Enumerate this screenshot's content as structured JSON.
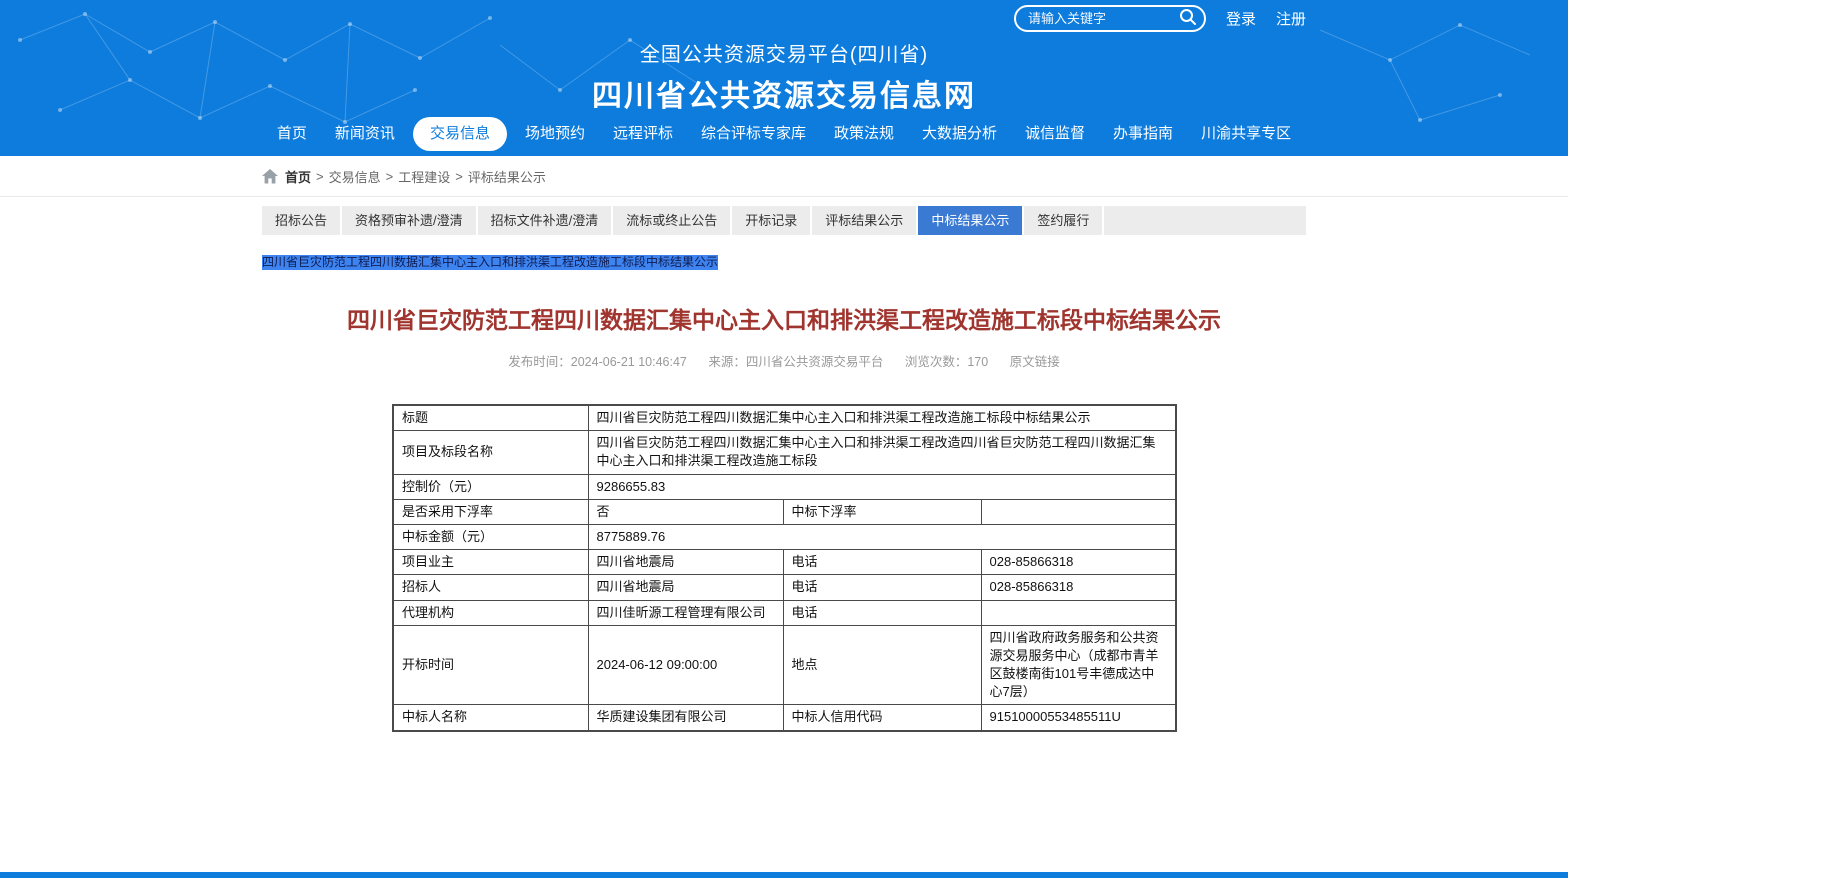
{
  "colors": {
    "header_blue": "#0d7cdd",
    "active_tab_blue": "#3b7ad3",
    "title_red": "#a0342e",
    "selection_blue": "#3d84f0"
  },
  "header": {
    "search_placeholder": "请输入关键字",
    "login_label": "登录",
    "register_label": "注册",
    "platform_title": "全国公共资源交易平台(四川省)",
    "site_title": "四川省公共资源交易信息网",
    "nav": [
      {
        "label": "首页"
      },
      {
        "label": "新闻资讯"
      },
      {
        "label": "交易信息",
        "active": true
      },
      {
        "label": "场地预约"
      },
      {
        "label": "远程评标"
      },
      {
        "label": "综合评标专家库"
      },
      {
        "label": "政策法规"
      },
      {
        "label": "大数据分析"
      },
      {
        "label": "诚信监督"
      },
      {
        "label": "办事指南"
      },
      {
        "label": "川渝共享专区"
      }
    ]
  },
  "breadcrumb": {
    "home_label": "首页",
    "items": [
      "交易信息",
      "工程建设",
      "评标结果公示"
    ]
  },
  "tabs": [
    {
      "label": "招标公告"
    },
    {
      "label": "资格预审补遗/澄清"
    },
    {
      "label": "招标文件补遗/澄清"
    },
    {
      "label": "流标或终止公告"
    },
    {
      "label": "开标记录"
    },
    {
      "label": "评标结果公示"
    },
    {
      "label": "中标结果公示",
      "active": true
    },
    {
      "label": "签约履行"
    }
  ],
  "selection_link": "四川省巨灾防范工程四川数据汇集中心主入口和排洪渠工程改造施工标段中标结果公示",
  "article": {
    "title": "四川省巨灾防范工程四川数据汇集中心主入口和排洪渠工程改造施工标段中标结果公示",
    "meta": {
      "publish": "发布时间：2024-06-21 10:46:47",
      "source": "来源：四川省公共资源交易平台",
      "views": "浏览次数：170",
      "original_link": "原文链接"
    }
  },
  "table": {
    "rows": [
      {
        "cells": [
          {
            "text": "标题"
          },
          {
            "text": "四川省巨灾防范工程四川数据汇集中心主入口和排洪渠工程改造施工标段中标结果公示",
            "colspan": 3
          }
        ]
      },
      {
        "cells": [
          {
            "text": "项目及标段名称"
          },
          {
            "text": "四川省巨灾防范工程四川数据汇集中心主入口和排洪渠工程改造四川省巨灾防范工程四川数据汇集中心主入口和排洪渠工程改造施工标段",
            "colspan": 3
          }
        ]
      },
      {
        "cells": [
          {
            "text": "控制价（元）"
          },
          {
            "text": "9286655.83",
            "colspan": 3
          }
        ]
      },
      {
        "cells": [
          {
            "text": "是否采用下浮率"
          },
          {
            "text": "否"
          },
          {
            "text": "中标下浮率"
          },
          {
            "text": ""
          }
        ]
      },
      {
        "cells": [
          {
            "text": "中标金额（元）"
          },
          {
            "text": "8775889.76",
            "colspan": 3
          }
        ]
      },
      {
        "cells": [
          {
            "text": "项目业主"
          },
          {
            "text": "四川省地震局"
          },
          {
            "text": "电话"
          },
          {
            "text": "028-85866318"
          }
        ]
      },
      {
        "cells": [
          {
            "text": "招标人"
          },
          {
            "text": "四川省地震局"
          },
          {
            "text": "电话"
          },
          {
            "text": "028-85866318"
          }
        ]
      },
      {
        "cells": [
          {
            "text": "代理机构"
          },
          {
            "text": "四川佳昕源工程管理有限公司"
          },
          {
            "text": "电话"
          },
          {
            "text": ""
          }
        ]
      },
      {
        "cells": [
          {
            "text": "开标时间"
          },
          {
            "text": "2024-06-12 09:00:00"
          },
          {
            "text": "地点"
          },
          {
            "text": "四川省政府政务服务和公共资源交易服务中心（成都市青羊区鼓楼南街101号丰德成达中心7层）"
          }
        ]
      },
      {
        "cells": [
          {
            "text": "中标人名称"
          },
          {
            "text": "华质建设集团有限公司"
          },
          {
            "text": "中标人信用代码"
          },
          {
            "text": "91510000553485511U"
          }
        ]
      }
    ]
  }
}
